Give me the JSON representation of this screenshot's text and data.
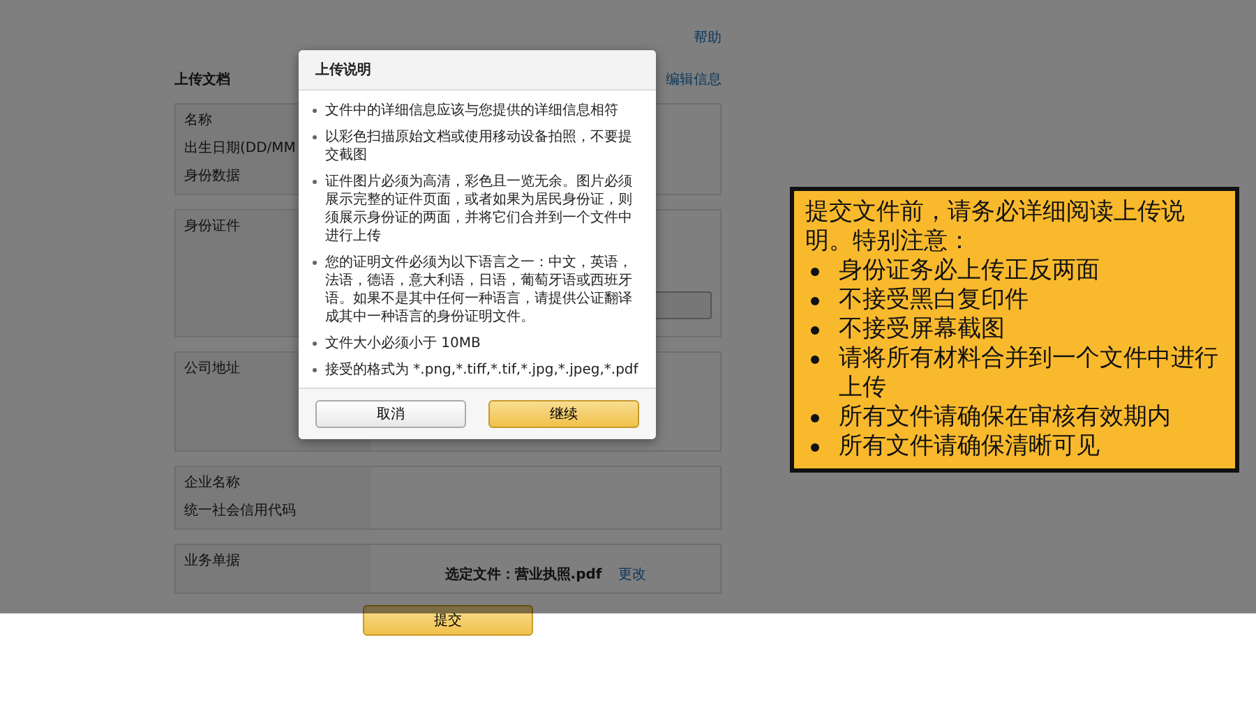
{
  "page": {
    "help_link": "帮助",
    "section_title": "上传文档",
    "edit_link": "编辑信息",
    "groups": [
      {
        "kind": "info",
        "labels": [
          "名称",
          "出生日期(DD/MM",
          "身份数据"
        ]
      },
      {
        "kind": "upload",
        "labels": [
          "身份证件"
        ]
      },
      {
        "kind": "text_area",
        "labels": [
          "公司地址"
        ]
      },
      {
        "kind": "info",
        "labels": [
          "企业名称",
          "统一社会信用代码"
        ]
      },
      {
        "kind": "file",
        "labels": [
          "业务单据"
        ],
        "file_label": "选定文件：",
        "file_name": "营业执照.pdf",
        "change_link": "更改"
      }
    ],
    "submit_button": "提交"
  },
  "dialog": {
    "title": "上传说明",
    "items": [
      "文件中的详细信息应该与您提供的详细信息相符",
      "以彩色扫描原始文档或使用移动设备拍照，不要提交截图",
      "证件图片必须为高清，彩色且一览无余。图片必须展示完整的证件页面，或者如果为居民身份证，则须展示身份证的两面，并将它们合并到一个文件中进行上传",
      "您的证明文件必须为以下语言之一：中文，英语，法语，德语，意大利语，日语，葡萄牙语或西班牙语。如果不是其中任何一种语言，请提供公证翻译成其中一种语言的身份证明文件。",
      "文件大小必须小于 10MB",
      "接受的格式为 *.png,*.tiff,*.tif,*.jpg,*.jpeg,*.pdf"
    ],
    "cancel_button": "取消",
    "continue_button": "继续"
  },
  "annotation": {
    "heading": "提交文件前，请务必详细阅读上传说明。特别注意：",
    "items": [
      "身份证务必上传正反两面",
      "不接受黑白复印件",
      "不接受屏幕截图",
      "请将所有材料合并到一个文件中进行上传",
      "所有文件请确保在审核有效期内",
      "所有文件请确保清晰可见"
    ]
  }
}
